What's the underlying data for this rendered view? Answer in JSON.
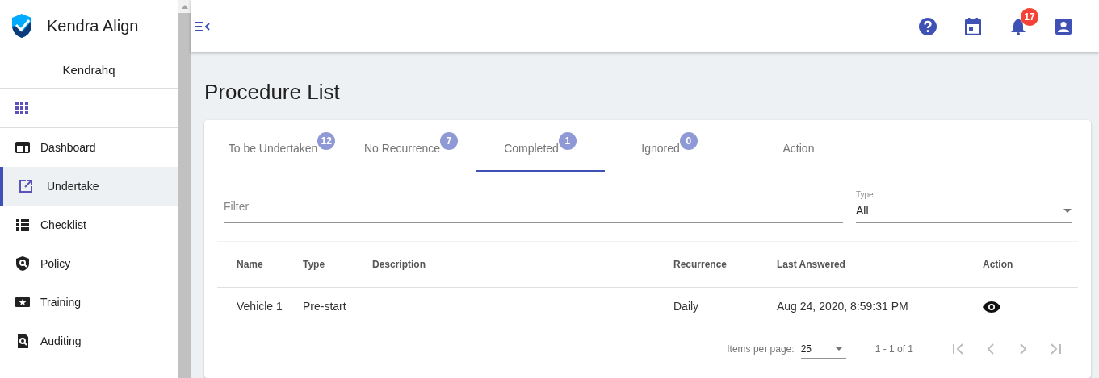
{
  "app": {
    "title": "Kendra Align",
    "organization": "Kendrahq"
  },
  "sidebar": {
    "items": [
      {
        "label": "Dashboard",
        "selected": false
      },
      {
        "label": "Undertake",
        "selected": true
      },
      {
        "label": "Checklist",
        "selected": false
      },
      {
        "label": "Policy",
        "selected": false
      },
      {
        "label": "Training",
        "selected": false
      },
      {
        "label": "Auditing",
        "selected": false
      }
    ]
  },
  "topbar": {
    "notification_count": "17"
  },
  "page_title": "Procedure List",
  "tabs": [
    {
      "label": "To be Undertaken",
      "count": "12",
      "selected": false
    },
    {
      "label": "No Recurrence",
      "count": "7",
      "selected": false
    },
    {
      "label": "Completed",
      "count": "1",
      "selected": true
    },
    {
      "label": "Ignored",
      "count": "0",
      "selected": false
    },
    {
      "label": "Action",
      "selected": false
    }
  ],
  "filter": {
    "placeholder": "Filter"
  },
  "type_select": {
    "label": "Type",
    "value": "All"
  },
  "table": {
    "columns": [
      "Name",
      "Type",
      "Description",
      "Recurrence",
      "Last Answered",
      "Action"
    ],
    "rows": [
      {
        "cells": [
          "Vehicle 1",
          "Pre-start",
          "",
          "Daily",
          "Aug 24, 2020, 8:59:31 PM"
        ]
      }
    ]
  },
  "paginator": {
    "label": "Items per page:",
    "page_size": "25",
    "range": "1 - 1 of 1"
  }
}
